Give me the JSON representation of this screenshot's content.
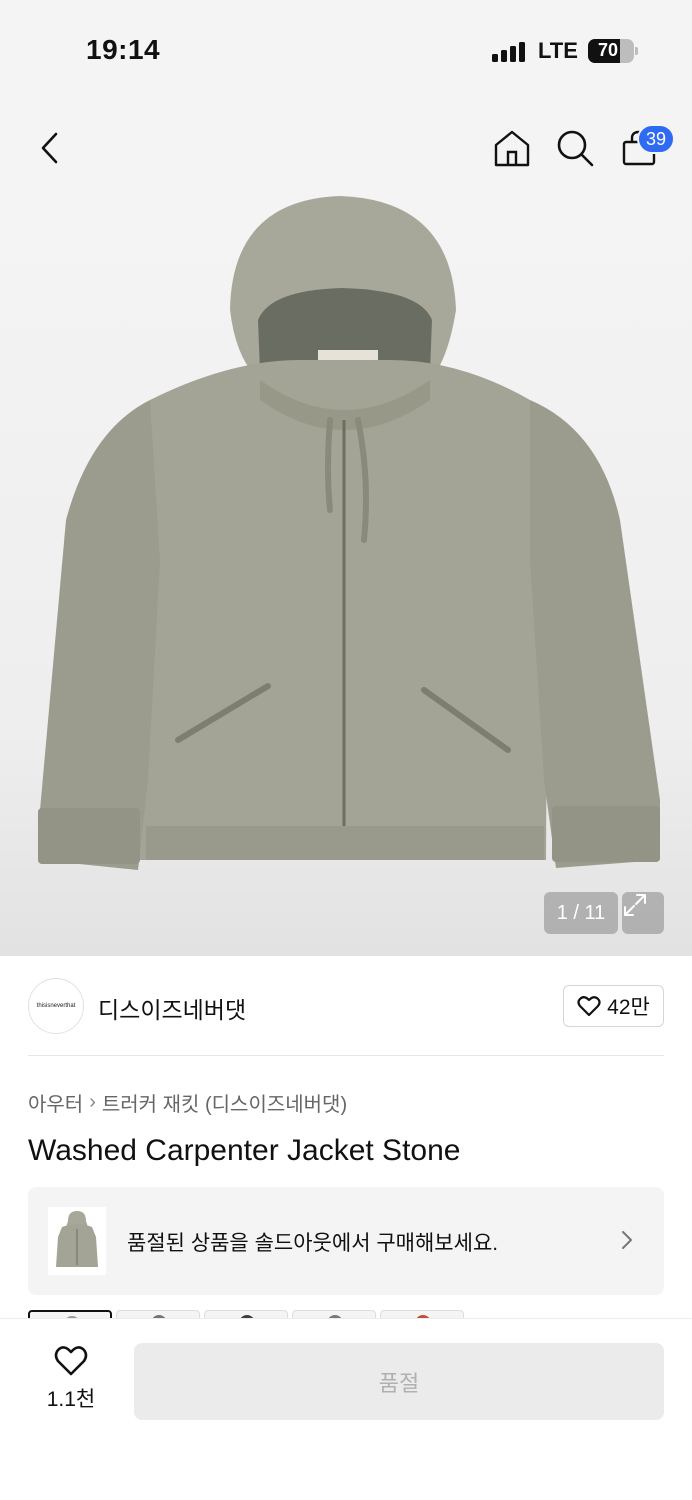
{
  "status_bar": {
    "time": "19:14",
    "network": "LTE",
    "battery": "70",
    "battery_level": 0.7
  },
  "nav": {
    "back_icon": "chevron-left-icon",
    "home_icon": "home-icon",
    "search_icon": "search-icon",
    "cart_icon": "shopping-bag-icon",
    "cart_count": "39",
    "badge_color": "#2f6bf2"
  },
  "gallery": {
    "counter": "1 / 11",
    "expand_icon": "expand-icon",
    "current_image": 1,
    "total_images": 11
  },
  "brand": {
    "logo_text": "thisisneverthat",
    "name": "디스이즈네버댓",
    "like_count": "42만"
  },
  "breadcrumb": {
    "category": "아우터",
    "separator": "›",
    "subcategory": "트러커 재킷 (디스이즈네버댓)"
  },
  "product": {
    "title": "Washed Carpenter Jacket Stone"
  },
  "soldout_banner": {
    "text": "품절된 상품을 솔드아웃에서 구매해보세요."
  },
  "swatch_colors": [
    "#9a9a8c",
    "#6c7a72",
    "#3e3e3e",
    "#7a7a72",
    "#c0503a"
  ],
  "bottom_bar": {
    "wish_count": "1.1천",
    "buy_label": "품절"
  }
}
